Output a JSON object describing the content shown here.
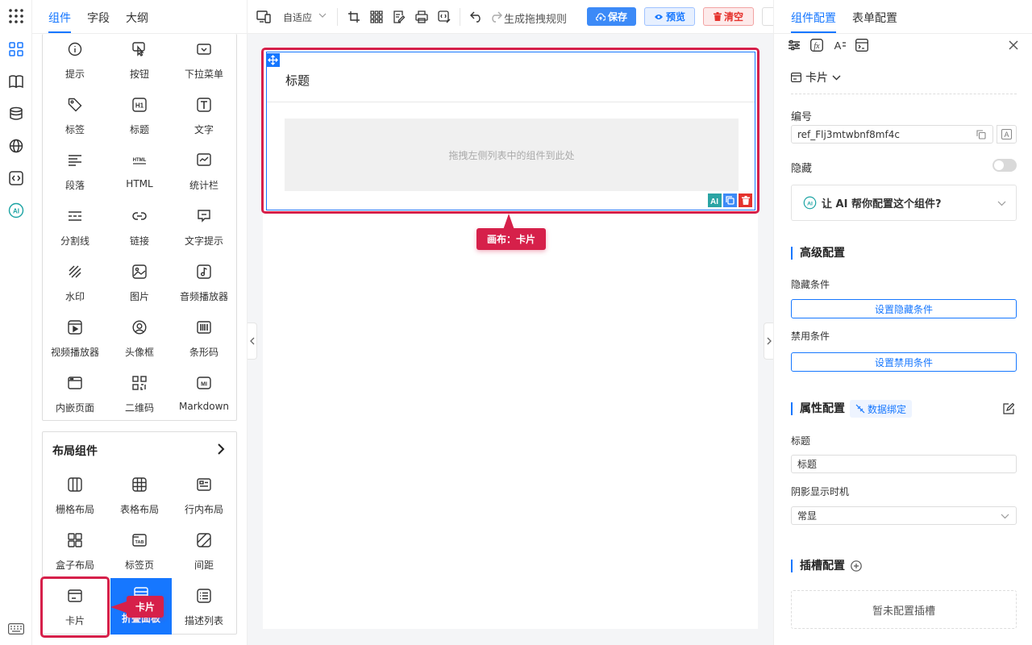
{
  "panel": {
    "tabs": [
      "组件",
      "字段",
      "大纲"
    ],
    "basic_components": [
      "提示",
      "按钮",
      "下拉菜单",
      "标签",
      "标题",
      "文字",
      "段落",
      "HTML",
      "统计栏",
      "分割线",
      "链接",
      "文字提示",
      "水印",
      "图片",
      "音频播放器",
      "视频播放器",
      "头像框",
      "条形码",
      "内嵌页面",
      "二维码",
      "Markdown"
    ],
    "layout_section_title": "布局组件",
    "layout_components": [
      "栅格布局",
      "表格布局",
      "行内布局",
      "盒子布局",
      "标签页",
      "间距",
      "卡片",
      "折叠面板",
      "描述列表"
    ]
  },
  "toolbar": {
    "device_label": "自适应",
    "rule_label": "生成拖拽规则",
    "save_label": "保存",
    "preview_label": "预览",
    "clear_label": "清空"
  },
  "canvas": {
    "card_title": "标题",
    "drop_placeholder": "拖拽左侧列表中的组件到此处",
    "callout_label": "画布：卡片",
    "left_callout_label": "卡片"
  },
  "right": {
    "tabs": [
      "组件配置",
      "表单配置"
    ],
    "component_type": "卡片",
    "id_label": "编号",
    "id_value": "ref_Flj3mtwbnf8mf4c",
    "id_badge": "A",
    "hidden_label": "隐藏",
    "hidden_on": false,
    "ai_prompt": "让 AI 帮你配置这个组件?",
    "advanced_title": "高级配置",
    "hide_cond_label": "隐藏条件",
    "hide_cond_button": "设置隐藏条件",
    "disable_cond_label": "禁用条件",
    "disable_cond_button": "设置禁用条件",
    "props_title": "属性配置",
    "data_binding": "数据绑定",
    "title_label": "标题",
    "title_value": "标题",
    "shadow_label": "阴影显示时机",
    "shadow_value": "常显",
    "slot_title": "插槽配置",
    "slot_empty": "暂未配置插槽"
  },
  "colors": {
    "primary": "#1677ff",
    "danger": "#d6204a",
    "callout": "#d6204a"
  }
}
